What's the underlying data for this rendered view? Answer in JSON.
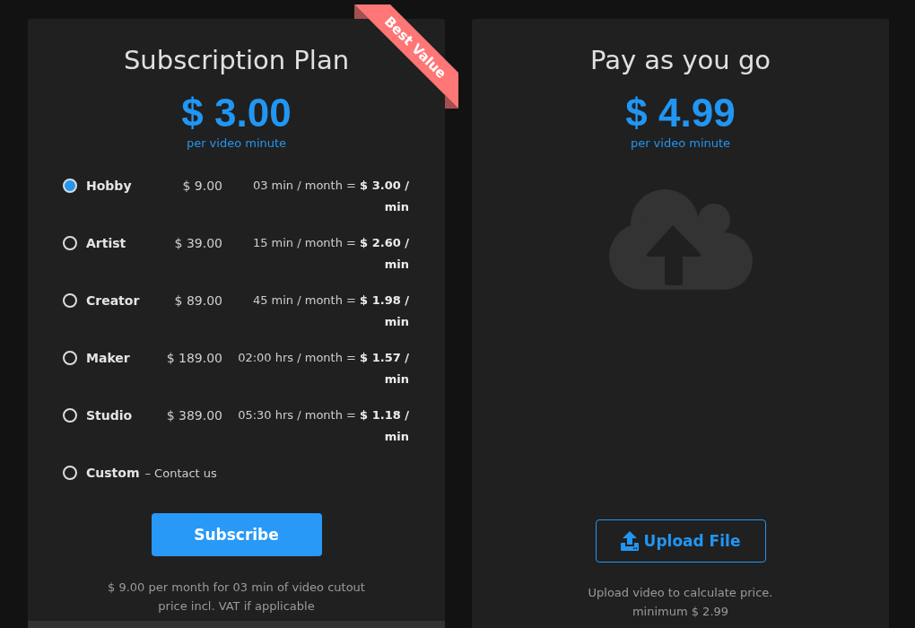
{
  "subscription_card": {
    "ribbon": "Best Value",
    "title": "Subscription Plan",
    "price": "$ 3.00",
    "price_unit": "per video minute",
    "plans": [
      {
        "kind": "plan",
        "label": "Hobby",
        "price": "$ 9.00",
        "detail": "03 min / month = **$ 3.00 / min**",
        "selected": true
      },
      {
        "kind": "plan",
        "label": "Artist",
        "price": "$ 39.00",
        "detail": "15 min / month = **$ 2.60 / min**",
        "selected": false
      },
      {
        "kind": "plan",
        "label": "Creator",
        "price": "$ 89.00",
        "detail": "45 min / month = **$ 1.98 / min**",
        "selected": false
      },
      {
        "kind": "plan",
        "label": "Maker",
        "price": "$ 189.00",
        "detail": "02:00 hrs / month = **$ 1.57 / min**",
        "selected": false
      },
      {
        "kind": "plan",
        "label": "Studio",
        "price": "$ 389.00",
        "detail": "05:30 hrs / month = **$ 1.18 / min**",
        "selected": false
      },
      {
        "kind": "custom",
        "label": "Custom",
        "note": "– Contact us",
        "selected": false
      }
    ],
    "button": "Subscribe",
    "notes": [
      "$ 9.00 per month for 03 min of video cutout",
      "price incl. VAT if applicable"
    ]
  },
  "payg_card": {
    "title": "Pay as you go",
    "price": "$ 4.99",
    "price_unit": "per video minute",
    "button": "Upload File",
    "notes": [
      "Upload video to calculate price.",
      "minimum $ 2.99"
    ]
  }
}
